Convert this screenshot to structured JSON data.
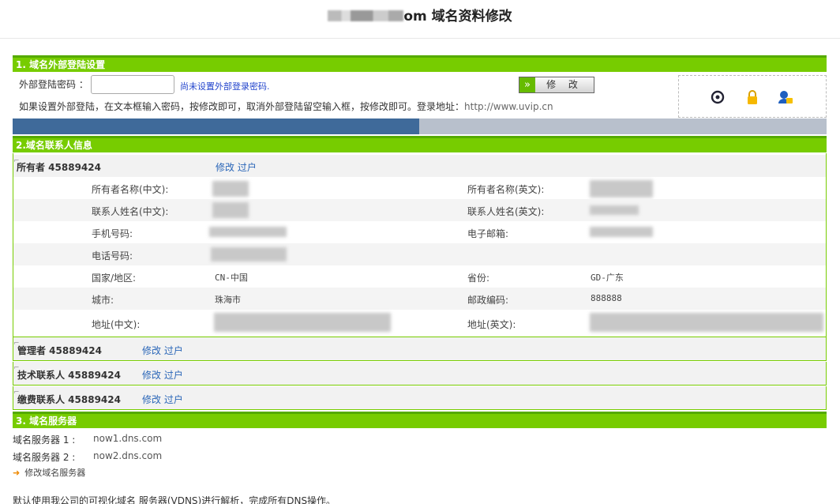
{
  "header": {
    "title_suffix": "om 域名资料修改"
  },
  "section1": {
    "title": "1. 域名外部登陆设置",
    "password_label": "外部登陆密码 ：",
    "password_value": "",
    "password_note": "尚未设置外部登录密码.",
    "edit_button": "修 改",
    "help_text": "如果设置外部登陆，在文本框输入密码，按修改即可，取消外部登陆留空输入框，按修改即可。登录地址：",
    "login_url": "http://www.uvip.cn",
    "icons": [
      "refresh-icon",
      "lock-icon",
      "user-lock-icon"
    ]
  },
  "section2": {
    "title": "2.域名联系人信息",
    "owner": {
      "name": "所有者 45889424",
      "edit": "修改",
      "transfer": "过户"
    },
    "fields": {
      "owner_name_cn": "所有者名称(中文):",
      "owner_name_en": "所有者名称(英文):",
      "contact_name_cn": "联系人姓名(中文):",
      "contact_name_en": "联系人姓名(英文):",
      "mobile": "手机号码:",
      "email": "电子邮箱:",
      "phone": "电话号码:",
      "country": "国家/地区:",
      "country_value": "CN-中国",
      "province": "省份:",
      "province_value": "GD-广东",
      "city": "城市:",
      "city_value": "珠海市",
      "zip": "邮政编码:",
      "zip_value": "888888",
      "address_cn": "地址(中文):",
      "address_en": "地址(英文):"
    },
    "admin": {
      "name": "管理者 45889424",
      "edit": "修改",
      "transfer": "过户"
    },
    "tech": {
      "name": "技术联系人 45889424",
      "edit": "修改",
      "transfer": "过户"
    },
    "billing": {
      "name": "缴费联系人 45889424",
      "edit": "修改",
      "transfer": "过户"
    }
  },
  "section3": {
    "title": "3. 域名服务器",
    "ns1_label": "域名服务器 1 :",
    "ns1_value": "now1.dns.com",
    "ns2_label": "域名服务器 2 :",
    "ns2_value": "now2.dns.com",
    "modify_link": "修改域名服务器",
    "note": "默认使用我公司的可视化域名 服务器(VDNS)进行解析，完成所有DNS操作。"
  },
  "colors": {
    "section_green": "#77cc00",
    "progress_blue": "#3f6a9a",
    "link_blue": "#2a66b8"
  }
}
